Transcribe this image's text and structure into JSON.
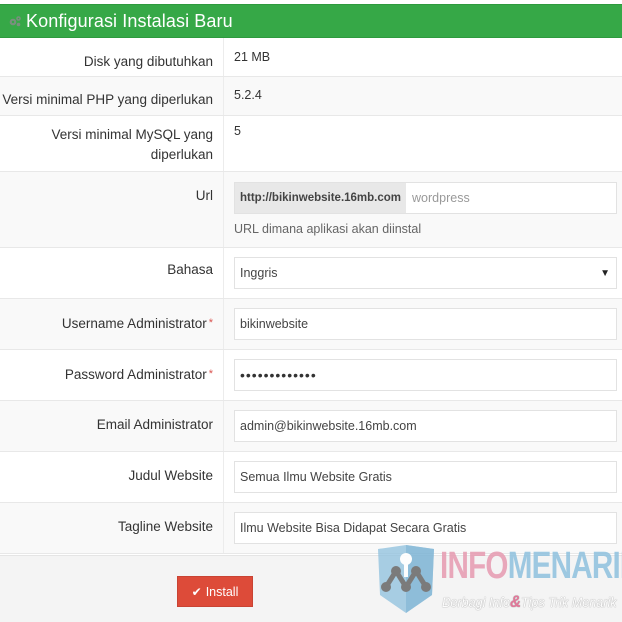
{
  "header": {
    "title": "Konfigurasi Instalasi Baru",
    "icon": "gears-icon",
    "color": "#36a847"
  },
  "info_rows": [
    {
      "label": "Disk yang dibutuhkan",
      "value": "21 MB"
    },
    {
      "label": "Versi minimal PHP yang diperlukan",
      "value": "5.2.4"
    },
    {
      "label": "Versi minimal MySQL yang diperlukan",
      "value": "5"
    }
  ],
  "url": {
    "label": "Url",
    "prefix": "http://bikinwebsite.16mb.com",
    "placeholder": "wordpress",
    "help": "URL dimana aplikasi akan diinstal"
  },
  "language": {
    "label": "Bahasa",
    "selected": "Inggris"
  },
  "fields": [
    {
      "label": "Username Administrator",
      "required": true,
      "value": "bikinwebsite"
    },
    {
      "label": "Password Administrator",
      "required": true,
      "value": "•••••••••••••"
    },
    {
      "label": "Email Administrator",
      "required": false,
      "value": "admin@bikinwebsite.16mb.com"
    },
    {
      "label": "Judul Website",
      "required": false,
      "value": "Semua Ilmu Website Gratis"
    },
    {
      "label": "Tagline Website",
      "required": false,
      "value": "Ilmu Website Bisa Didapat Secara Gratis"
    }
  ],
  "required_marker": "*",
  "install_button": {
    "label": "Install",
    "icon": "check-icon",
    "color": "#dd4b39"
  },
  "watermark": {
    "brand_part1": "INFO",
    "brand_part2": "MENARIK",
    "tagline_part1": "Berbagi Info",
    "ampersand": "&",
    "tagline_part2": "Tips Trik Menarik"
  }
}
